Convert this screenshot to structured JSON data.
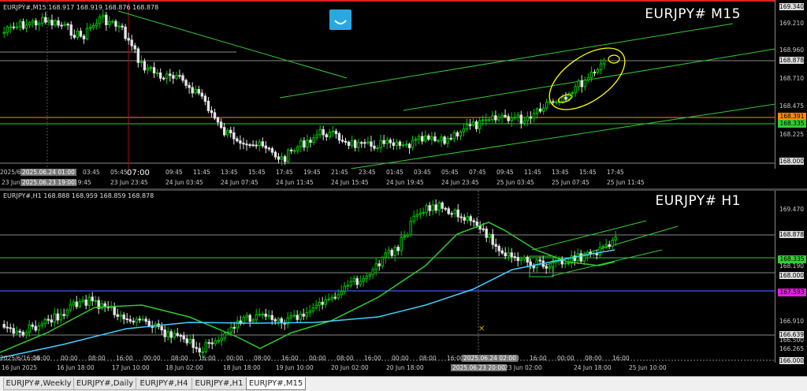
{
  "top_chart": {
    "info": "EURJPY#,M15  168.917 168.919 168.876 168.878",
    "symbol": "EURJPY# M15",
    "price_labels": [
      "169.340",
      "169.210",
      "168.960",
      "168.878",
      "168.710",
      "168.475",
      "168.391",
      "168.335",
      "168.225",
      "168.000"
    ],
    "time_labels": [
      "03:45",
      "05:45",
      "07:00",
      "09:45",
      "11:45",
      "13:45",
      "15:45",
      "17:45",
      "19:45",
      "21:45",
      "23:45",
      "01:45",
      "03:45",
      "05:45",
      "07:45",
      "09:45",
      "11:45",
      "13:45",
      "15:45",
      "17:45"
    ],
    "crosshair_time": "2025.06.24 01:00",
    "crosshair_time2": "2025.06.23 19:00",
    "date_labels": [
      "2025/6/",
      "23 Jun 19:45",
      "23 Jun 23:45",
      "24 Jun 03:45",
      "24 Jun 07:45",
      "24 Jun 11:45",
      "24 Jun 15:45",
      "24 Jun 19:45",
      "24 Jun 23:45",
      "25 Jun 03:45",
      "25 Jun 07:45",
      "25 Jun 11:45"
    ],
    "date_label_prefix": "23 Jun",
    "tags": {
      "orange": "168.391",
      "green": "168.335"
    }
  },
  "bottom_chart": {
    "info": "EURJPY#,H1  168.888 168.959 168.859 168.878",
    "symbol": "EURJPY# H1",
    "price_labels": [
      "169.470",
      "168.878",
      "168.190",
      "168.000",
      "166.910",
      "166.639",
      "166.500",
      "166.265",
      "166.000"
    ],
    "time_labels": [
      "16:00",
      "00:00",
      "08:00",
      "16:00",
      "00:00",
      "08:00",
      "16:00",
      "00:00",
      "08:00",
      "16:00",
      "00:00",
      "08:00",
      "16:00",
      "00:00",
      "08:00",
      "16:00",
      "00:00",
      "08:00",
      "16:00",
      "00:00",
      "08:00",
      "16:00"
    ],
    "crosshair_time": "2025.06.24 02:00",
    "crosshair_time2": "2025.06.23 20:00",
    "date_labels": [
      "16 Jun 2025",
      "16 Jun 18:00",
      "17 Jun 10:00",
      "18 Jun 02:00",
      "18 Jun 18:00",
      "19 Jun 10:00",
      "20 Jun 02:00",
      "20 Jun 18:00",
      "23 Jun 02:00",
      "24 Jun 18:00",
      "25 Jun 10:00"
    ],
    "axis_start": "2025/6/16:00",
    "tags": {
      "green": "168.335",
      "magenta": "167.593"
    }
  },
  "tabs": [
    "EURJPY#,Weekly",
    "EURJPY#,Daily",
    "EURJPY#,H4",
    "EURJPY#,H1",
    "EURJPY#,M15"
  ],
  "active_tab": "EURJPY#,M15",
  "colors": {
    "bull": "#00c800",
    "bear": "#e6e6e6",
    "ma_fast": "#2ecc2e",
    "ma_slow": "#40d0ff",
    "channel": "#33cc33",
    "highlight": "#ffff00",
    "orange_level": "#ff8c00",
    "blue_level": "#3b5bff",
    "magenta_tag": "#e020e0"
  }
}
